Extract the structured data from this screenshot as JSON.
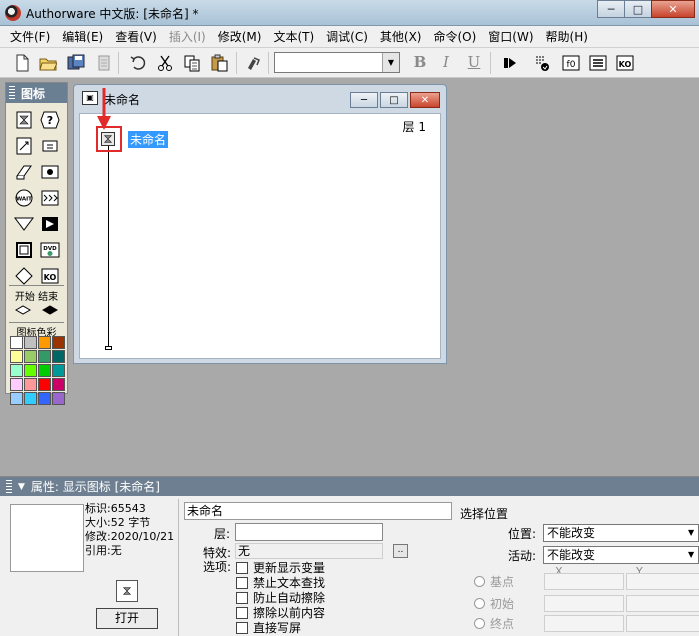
{
  "app": {
    "title": "Authorware 中文版: [未命名] *",
    "window_buttons": {
      "minimize": "─",
      "maximize": "□",
      "close": "✕"
    }
  },
  "menu": [
    {
      "label": "文件(F)",
      "enabled": true
    },
    {
      "label": "编辑(E)",
      "enabled": true
    },
    {
      "label": "查看(V)",
      "enabled": true
    },
    {
      "label": "插入(I)",
      "enabled": false
    },
    {
      "label": "修改(M)",
      "enabled": true
    },
    {
      "label": "文本(T)",
      "enabled": true
    },
    {
      "label": "调试(C)",
      "enabled": true
    },
    {
      "label": "其他(X)",
      "enabled": true
    },
    {
      "label": "命令(O)",
      "enabled": true
    },
    {
      "label": "窗口(W)",
      "enabled": true
    },
    {
      "label": "帮助(H)",
      "enabled": true
    }
  ],
  "toolbar": {
    "font_value": "",
    "format_buttons": [
      "B",
      "I",
      "U"
    ],
    "icons": [
      "new-file-icon",
      "open-folder-icon",
      "save-all-icon",
      "import-icon",
      "undo-icon",
      "cut-icon",
      "copy-icon",
      "paste-icon",
      "find-icon",
      "run-icon",
      "control-panel-icon",
      "functions-icon",
      "variables-icon",
      "knowledge-objects-icon"
    ],
    "text_icons": {
      "functions": "f0",
      "knowledge_objects": "KO"
    }
  },
  "palette": {
    "title": "图标",
    "icons": [
      "display-icon",
      "interaction-icon",
      "motion-icon",
      "calculation-icon",
      "erase-icon",
      "navigation-icon",
      "wait-icon",
      "framework-icon",
      "decision-icon",
      "digital-movie-icon",
      "map-icon",
      "dvd-icon",
      "navigate-diamond-icon",
      "knowledge-object-icon"
    ],
    "icon_text": {
      "wait": "WAIT",
      "dvd": "DVD",
      "knowledge_object": "KO"
    },
    "start_end_label": "开始 结束",
    "color_label": "图标色彩",
    "colors": [
      "#ffffff",
      "#c0c0c0",
      "#ff9900",
      "#993300",
      "#ffff99",
      "#99cc66",
      "#339966",
      "#006666",
      "#99ffcc",
      "#66ff00",
      "#00cc00",
      "#009999",
      "#ffccff",
      "#ff9999",
      "#ff0000",
      "#cc0066",
      "#99ccff",
      "#33ccff",
      "#3366ff",
      "#9966cc"
    ]
  },
  "design_window": {
    "title": "未命名",
    "layer_label": "层 1",
    "flow_icon_label": "未命名"
  },
  "properties": {
    "header": "属性: 显示图标 [未命名]",
    "info": {
      "id": "标识:65543",
      "size": "大小:52 字节",
      "modified": "修改:2020/10/21",
      "ref": "引用:无"
    },
    "open_button": "打开",
    "name_value": "未命名",
    "layer_label": "层:",
    "layer_value": "",
    "effect_label": "特效:",
    "effect_value": "无",
    "effect_button": "..",
    "options_label": "选项:",
    "options": [
      {
        "label": "更新显示变量",
        "checked": false
      },
      {
        "label": "禁止文本查找",
        "checked": false
      },
      {
        "label": "防止自动擦除",
        "checked": false
      },
      {
        "label": "擦除以前内容",
        "checked": false
      },
      {
        "label": "直接写屏",
        "checked": false
      }
    ],
    "select_position_label": "选择位置",
    "position_label": "位置:",
    "position_value": "不能改变",
    "activity_label": "活动:",
    "activity_value": "不能改变",
    "radios": [
      "基点",
      "初始",
      "终点"
    ],
    "coord_x": "X",
    "coord_y": "Y"
  }
}
